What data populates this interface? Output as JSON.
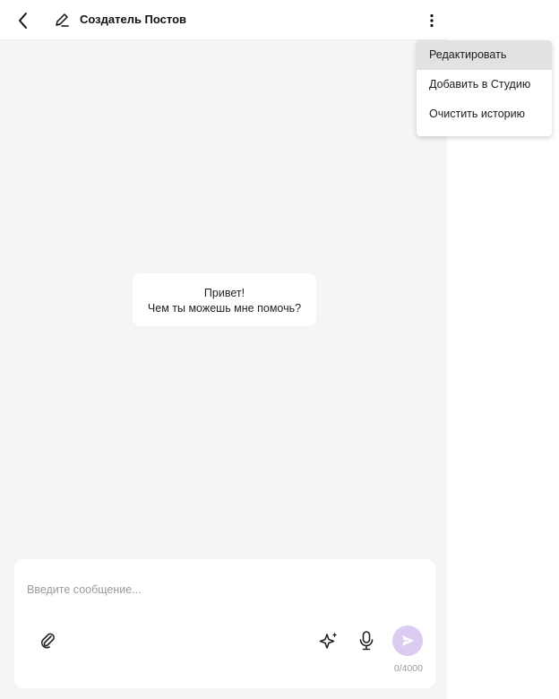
{
  "header": {
    "title": "Создатель Постов",
    "back_icon": "chevron-left-icon",
    "bot_icon": "pen-icon",
    "more_icon": "more-vertical-icon"
  },
  "chat": {
    "greeting": {
      "line1": "Привет!",
      "line2": "Чем ты можешь мне помочь?"
    }
  },
  "composer": {
    "placeholder": "Введите сообщение...",
    "value": "",
    "counter": "0/4000",
    "icons": [
      "paperclip-icon",
      "sparkle-icon",
      "microphone-icon",
      "send-icon"
    ],
    "send_color": "#d9ccf0"
  },
  "menu": {
    "items": [
      {
        "label": "Редактировать",
        "active": true
      },
      {
        "label": "Добавить в Студию",
        "active": false
      },
      {
        "label": "Очистить историю",
        "active": false
      }
    ]
  },
  "colors": {
    "background": "#f5f5f5",
    "accent": "#d9ccf0"
  }
}
